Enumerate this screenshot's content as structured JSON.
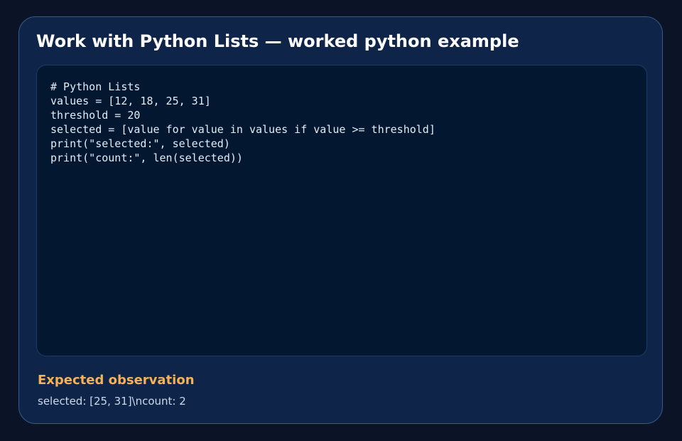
{
  "title": "Work with Python Lists — worked python example",
  "code": {
    "language": "python",
    "lines": [
      "# Python Lists",
      "values = [12, 18, 25, 31]",
      "threshold = 20",
      "selected = [value for value in values if value >= threshold]",
      "print(\"selected:\", selected)",
      "print(\"count:\", len(selected))"
    ]
  },
  "observation": {
    "heading": "Expected observation",
    "text": "selected: [25, 31]\\ncount: 2"
  },
  "colors": {
    "background": "#0a1426",
    "card": "#0f2449",
    "code_panel": "#031731",
    "heading_accent": "#f5b155"
  }
}
